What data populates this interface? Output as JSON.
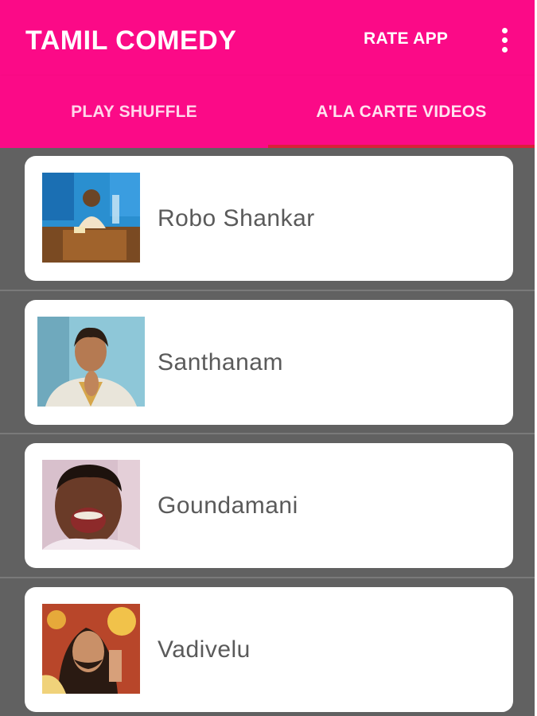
{
  "app_bar": {
    "title": "TAMIL COMEDY",
    "rate_label": "RATE APP",
    "overflow_icon": "more-vert-icon",
    "color": "#fb0a87"
  },
  "tabs": [
    {
      "label": "PLAY SHUFFLE",
      "selected": false
    },
    {
      "label": "A'LA CARTE VIDEOS",
      "selected": true
    }
  ],
  "tab_indicator_color": "#d9203a",
  "list_background": "#616161",
  "comedians": [
    {
      "name": "Robo Shankar",
      "thumbnail": "thumbnail-robo-shankar"
    },
    {
      "name": "Santhanam",
      "thumbnail": "thumbnail-santhanam"
    },
    {
      "name": "Goundamani",
      "thumbnail": "thumbnail-goundamani"
    },
    {
      "name": "Vadivelu",
      "thumbnail": "thumbnail-vadivelu"
    }
  ]
}
